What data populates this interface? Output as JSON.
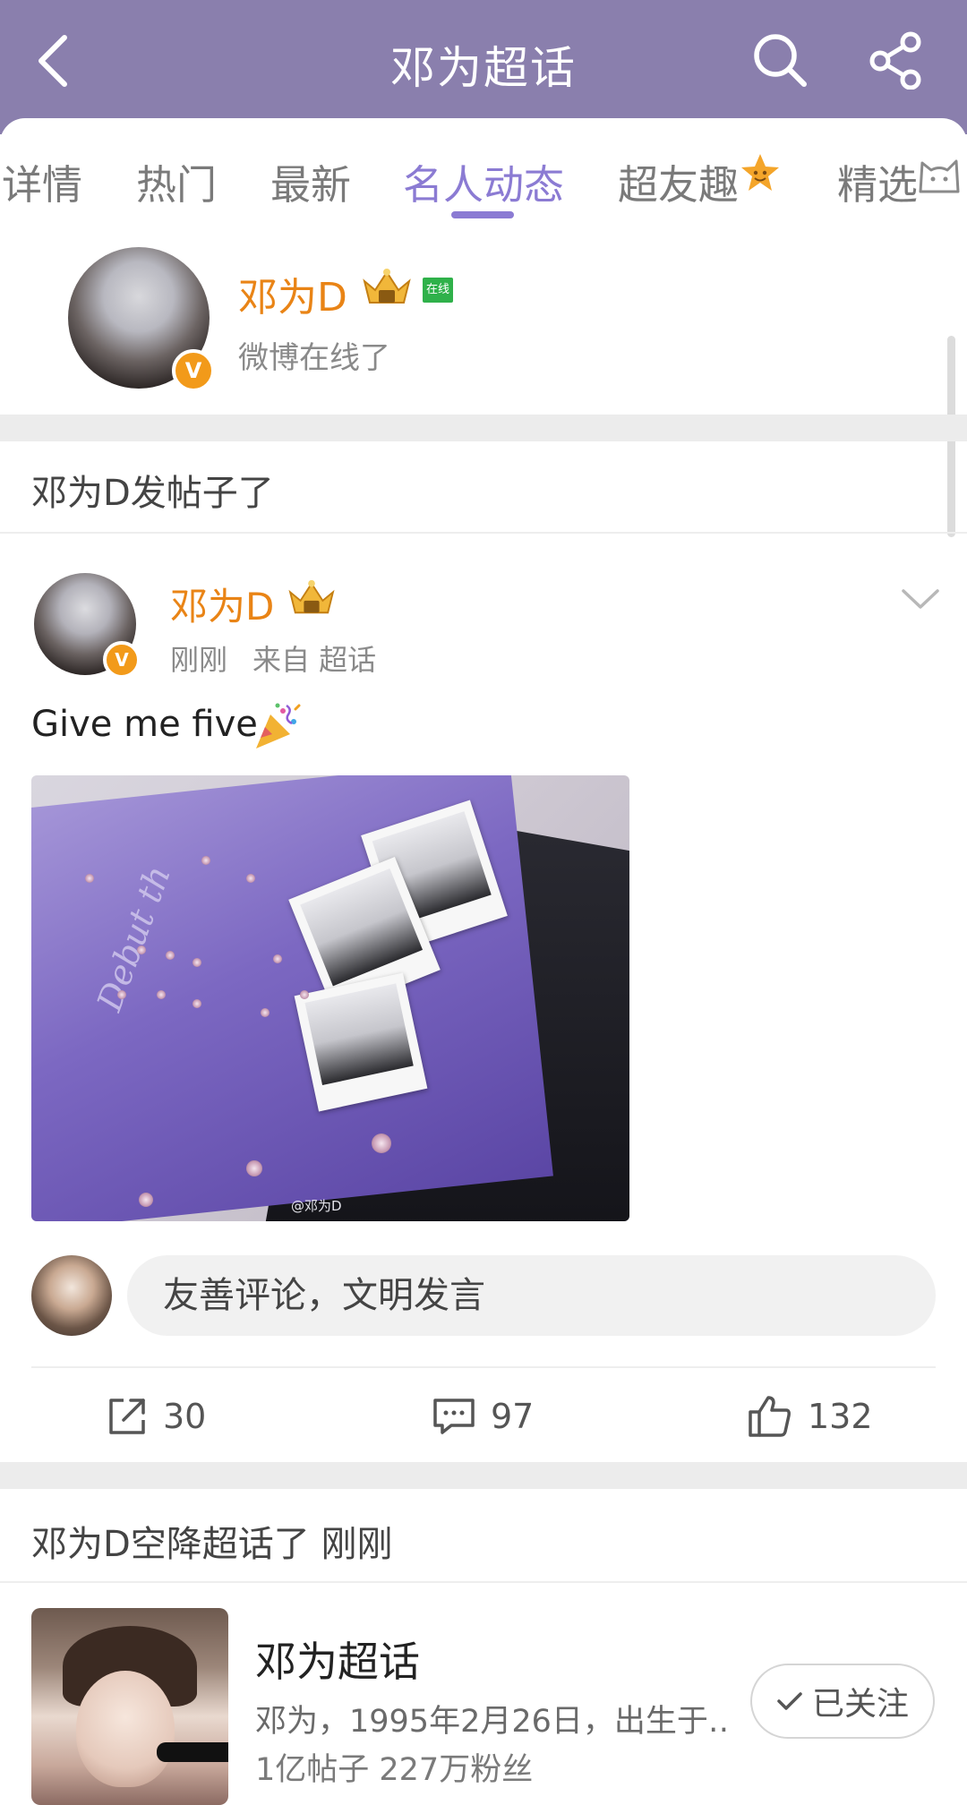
{
  "header": {
    "title": "邓为超话",
    "back_icon": "back-arrow-icon",
    "search_icon": "search-icon",
    "share_icon": "share-icon",
    "bg_color": "#8a7fad"
  },
  "tabs": [
    {
      "label": "详情"
    },
    {
      "label": "热门"
    },
    {
      "label": "最新"
    },
    {
      "label": "名人动态",
      "active": true
    },
    {
      "label": "超友趣"
    },
    {
      "label": "精选"
    }
  ],
  "online": {
    "name": "邓为D",
    "online_tag": "在线",
    "status": "微博在线了",
    "v_badge": "V"
  },
  "post_section": {
    "heading": "邓为D发帖子了"
  },
  "post": {
    "author": "邓为D",
    "v_badge": "V",
    "time": "刚刚",
    "source": "来自 超话",
    "text": "Give me five",
    "image_watermark": "@邓为D",
    "image_scribble": "Debut th",
    "comment_placeholder": "友善评论，文明发言",
    "reposts": "30",
    "comments": "97",
    "likes": "132"
  },
  "airdrop_section": {
    "heading": "邓为D空降超话了 刚刚"
  },
  "supertopic": {
    "title": "邓为超话",
    "description": "邓为，1995年2月26日，出生于…",
    "stats": "1亿帖子  227万粉丝",
    "follow_label": "已关注"
  },
  "colors": {
    "accent_purple": "#8b7bd3",
    "name_orange": "#e98416",
    "online_green": "#2fb14a",
    "v_badge": "#f29a1a"
  }
}
